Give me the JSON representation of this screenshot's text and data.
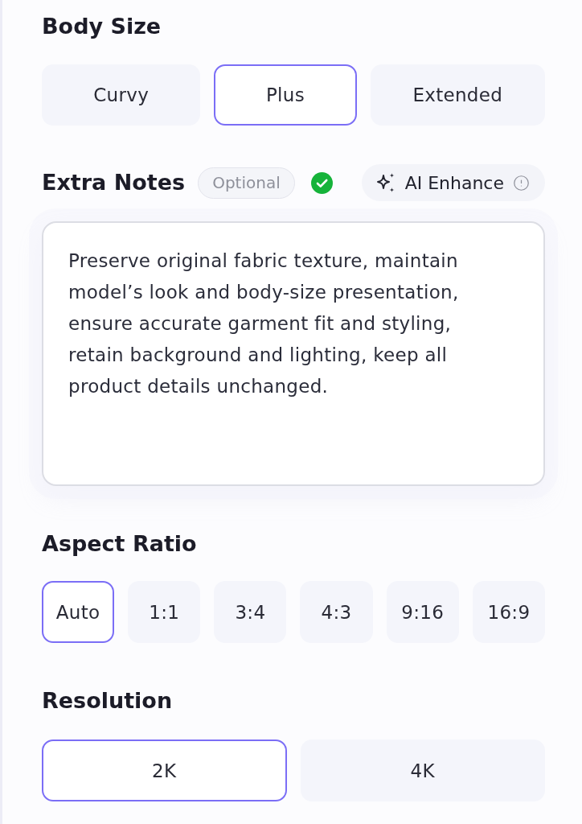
{
  "body_size": {
    "title": "Body Size",
    "options": [
      {
        "label": "Curvy",
        "selected": false
      },
      {
        "label": "Plus",
        "selected": true
      },
      {
        "label": "Extended",
        "selected": false
      }
    ]
  },
  "extra_notes": {
    "title": "Extra Notes",
    "badge": "Optional",
    "complete": true,
    "ai_button": {
      "label": "AI Enhance"
    },
    "notes": {
      "value": "Preserve original fabric texture, maintain model’s look and body-size presentation, ensure accurate garment fit and styling, retain background and lighting, keep all product details unchanged."
    }
  },
  "aspect_ratio": {
    "title": "Aspect Ratio",
    "options": [
      {
        "label": "Auto",
        "selected": true
      },
      {
        "label": "1:1",
        "selected": false
      },
      {
        "label": "3:4",
        "selected": false
      },
      {
        "label": "4:3",
        "selected": false
      },
      {
        "label": "9:16",
        "selected": false
      },
      {
        "label": "16:9",
        "selected": false
      }
    ]
  },
  "resolution": {
    "title": "Resolution",
    "options": [
      {
        "label": "2K",
        "selected": true
      },
      {
        "label": "4K",
        "selected": false
      }
    ]
  }
}
